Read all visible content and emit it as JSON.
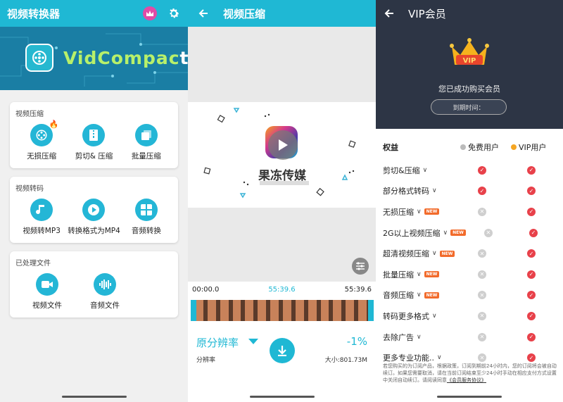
{
  "screen1": {
    "title": "视频转换器",
    "banner_brand_a": "VidCompac",
    "banner_brand_b": "t",
    "sections": [
      {
        "title": "视频压缩",
        "items": [
          {
            "label": "无损压缩",
            "icon": "film-reel-icon",
            "hot": true
          },
          {
            "label": "剪切& 压缩",
            "icon": "zip-icon"
          },
          {
            "label": "批量压缩",
            "icon": "batch-icon"
          }
        ]
      },
      {
        "title": "视频转码",
        "items": [
          {
            "label": "视频转MP3",
            "icon": "music-note-icon"
          },
          {
            "label": "转换格式为MP4",
            "icon": "play-icon"
          },
          {
            "label": "音频转换",
            "icon": "audio-convert-icon"
          }
        ]
      },
      {
        "title": "已处理文件",
        "items": [
          {
            "label": "视频文件",
            "icon": "video-camera-icon"
          },
          {
            "label": "音频文件",
            "icon": "waveform-icon"
          }
        ]
      }
    ]
  },
  "screen2": {
    "title": "视频压缩",
    "watermark": "果冻传媒",
    "time_start": "00:00.0",
    "time_mid": "55:39.6",
    "time_end": "55:39.6",
    "resolution": "原分辨率",
    "resolution_sub": "分辨率",
    "percent": "-1%",
    "size": "大小:801.73M"
  },
  "screen3": {
    "title": "VIP会员",
    "crown_text": "VIP",
    "success_msg": "您已成功购买会员",
    "expire_label": "到期时间：",
    "col_feature": "权益",
    "col_free": "免费用户",
    "col_vip": "VIP用户",
    "rows": [
      {
        "name": "剪切&压缩",
        "new": false,
        "free": true,
        "vip": true
      },
      {
        "name": "部分格式转码",
        "new": false,
        "free": true,
        "vip": true
      },
      {
        "name": "无损压缩",
        "new": true,
        "free": false,
        "vip": true
      },
      {
        "name": "2G以上视频压缩",
        "new": true,
        "free": false,
        "vip": true
      },
      {
        "name": "超清视频压缩",
        "new": true,
        "free": false,
        "vip": true
      },
      {
        "name": "批量压缩",
        "new": true,
        "free": false,
        "vip": true
      },
      {
        "name": "音频压缩",
        "new": true,
        "free": false,
        "vip": true
      },
      {
        "name": "转码更多格式",
        "new": false,
        "free": false,
        "vip": true
      },
      {
        "name": "去除广告",
        "new": false,
        "free": false,
        "vip": true
      },
      {
        "name": "更多专业功能..",
        "new": false,
        "free": false,
        "vip": true
      }
    ],
    "new_badge": "NEW",
    "disclaimer": "若您购买的为订阅产品，根据政策，订阅到期前24小时内，您的订阅将会被自动续订。如果您需要取消，请在当前订阅结束至少24小时手动在相应支付方式设置中关闭自动续订。请阅读同意",
    "disclaimer_link": "《会员服务协议》"
  },
  "colors": {
    "accent": "#1fb8d4",
    "vip_dark": "#2d3545",
    "check_red": "#e8414a",
    "new_orange": "#f26b2b"
  }
}
